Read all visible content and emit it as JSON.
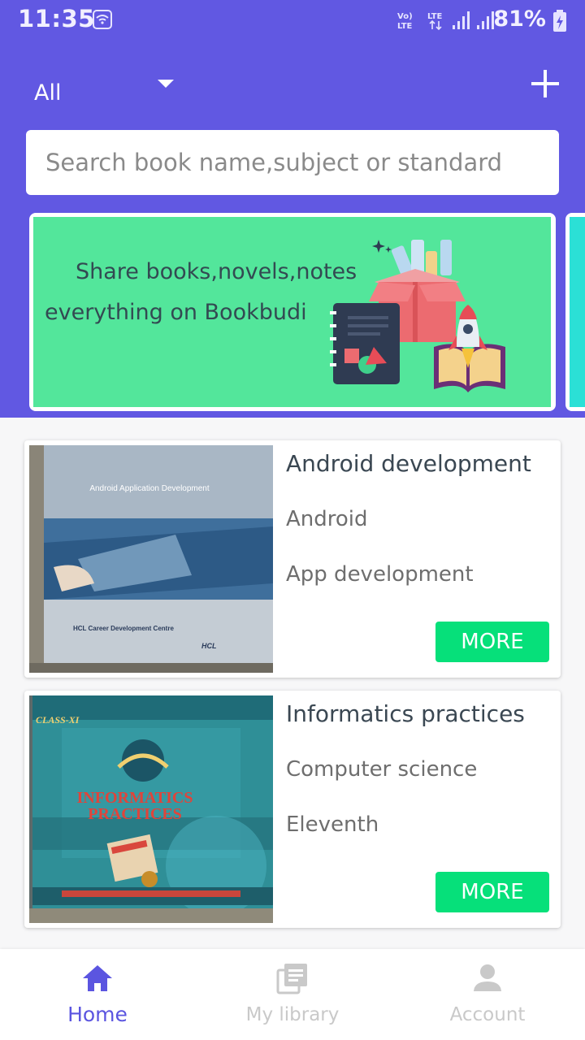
{
  "status_bar": {
    "time": "11:35",
    "battery": "81%",
    "icons": [
      "wifi-icon",
      "volte-icon",
      "lte-icon",
      "signal-icon",
      "signal-icon",
      "battery-charging-icon"
    ]
  },
  "header": {
    "filter_label": "All",
    "add_icon": "plus-icon",
    "accent_color": "#6158e2"
  },
  "search": {
    "placeholder": "Search book name,subject or standard"
  },
  "banner": {
    "line1": "Share books,novels,notes",
    "line2": "everything on Bookbudi",
    "background": "#53e69b"
  },
  "books": [
    {
      "title": "Android development",
      "subject": "Android",
      "standard": "App development",
      "button": "MORE",
      "cover_title": "Android Application Development",
      "cover_footer": "HCL Career Development Centre",
      "cover_brand": "HCL"
    },
    {
      "title": "Informatics practices",
      "subject": "Computer science",
      "standard": "Eleventh",
      "button": "MORE",
      "cover_top": "CLASS-XI",
      "cover_title_1": "INFORMATICS",
      "cover_title_2": "PRACTICES"
    }
  ],
  "bottom_nav": {
    "items": [
      {
        "label": "Home",
        "icon": "home-icon",
        "active": true
      },
      {
        "label": "My library",
        "icon": "library-icon",
        "active": false
      },
      {
        "label": "Account",
        "icon": "account-icon",
        "active": false
      }
    ],
    "active_color": "#5b55e0",
    "button_color": "#06e07a"
  }
}
